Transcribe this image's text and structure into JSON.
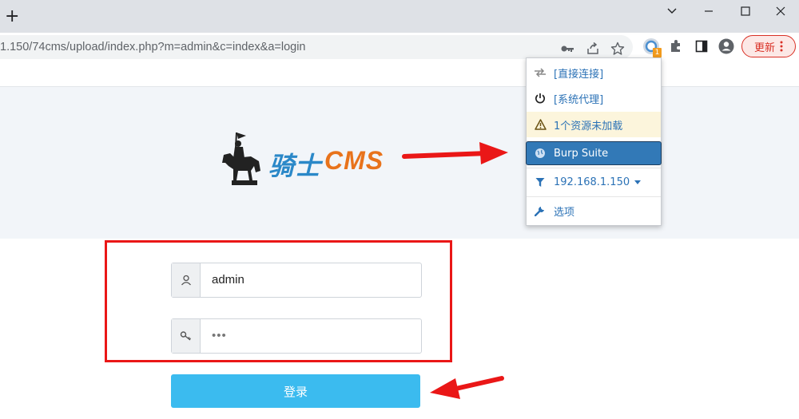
{
  "browser": {
    "new_tab_icon": "plus-icon",
    "url": "1.150/74cms/upload/index.php?m=admin&c=index&a=login",
    "update_label": "更新",
    "extension_badge": "1"
  },
  "page": {
    "logo_text": "骑士",
    "logo_cms": "CMS",
    "username_value": "admin",
    "password_value": "•••",
    "login_label": "登录"
  },
  "proxy_menu": {
    "items": [
      {
        "label": "[直接连接]",
        "icon": "direct-connect-icon"
      },
      {
        "label": "[系统代理]",
        "icon": "power-icon"
      },
      {
        "label": "1个资源未加载",
        "icon": "warning-icon"
      },
      {
        "label": "Burp Suite",
        "icon": "globe-icon"
      },
      {
        "label": "192.168.1.150",
        "icon": "filter-icon"
      },
      {
        "label": "选项",
        "icon": "wrench-icon"
      }
    ]
  },
  "colors": {
    "annotation_red": "#ea1717",
    "login_button": "#3bbbef",
    "selected_proxy": "#3279b7"
  }
}
